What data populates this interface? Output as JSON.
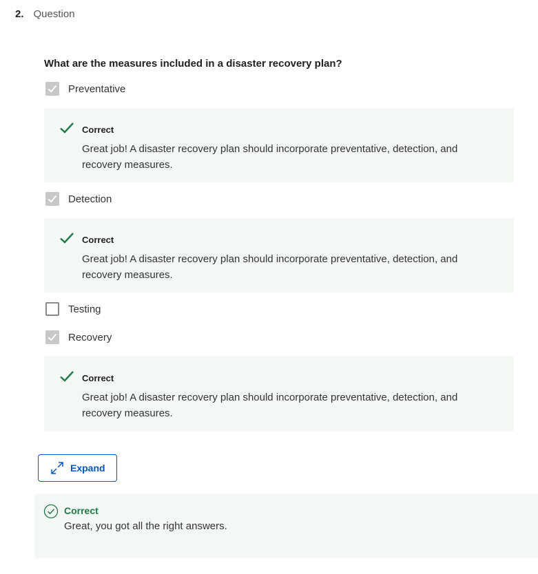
{
  "question": {
    "number": "2.",
    "label": "Question",
    "prompt": "What are the measures included in a disaster recovery plan?"
  },
  "options": [
    {
      "label": "Preventative",
      "checked": true,
      "feedback": {
        "title": "Correct",
        "text": "Great job! A disaster recovery plan should incorporate preventative, detection, and recovery measures."
      }
    },
    {
      "label": "Detection",
      "checked": true,
      "feedback": {
        "title": "Correct",
        "text": "Great job! A disaster recovery plan should incorporate preventative, detection, and recovery measures."
      }
    },
    {
      "label": "Testing",
      "checked": false
    },
    {
      "label": "Recovery",
      "checked": true,
      "feedback": {
        "title": "Correct",
        "text": "Great job! A disaster recovery plan should incorporate preventative, detection, and recovery measures."
      }
    }
  ],
  "expand_button": {
    "label": "Expand",
    "icon": "expand-arrows-icon"
  },
  "result": {
    "icon": "check-circle-icon",
    "title": "Correct",
    "text": "Great, you got all the right answers."
  },
  "colors": {
    "correct_green": "#1e7a46",
    "feedback_background": "#f3f8f5",
    "accent_blue": "#0056d2",
    "checkbox_checked": "#c8c8c8"
  }
}
